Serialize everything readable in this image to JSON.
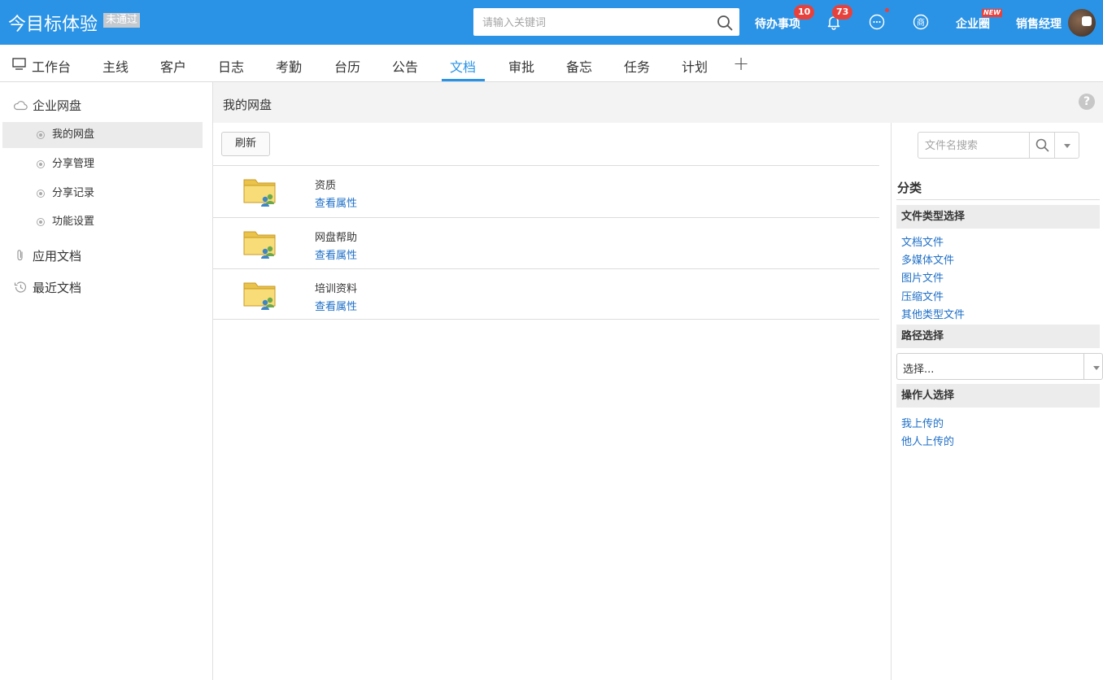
{
  "app": {
    "title": "今目标体验",
    "status_badge": "未通过"
  },
  "search": {
    "placeholder": "请输入关键词"
  },
  "top_links": {
    "todo_label": "待办事项",
    "todo_count": "10",
    "notify_count": "73",
    "circle_label": "企业圈",
    "circle_new_tag": "NEW",
    "user_role": "销售经理"
  },
  "icons": {
    "search": "search-icon",
    "bell": "bell-icon",
    "chat": "chat-bubble-icon",
    "shop": "shop-icon",
    "cloud": "cloud-icon",
    "paperclip": "paperclip-icon",
    "history": "history-icon",
    "help": "help-icon",
    "folder": "shared-folder-icon"
  },
  "colors": {
    "primary": "#2a93e6",
    "badge": "#e8413c",
    "link": "#1e6fc7"
  },
  "nav": {
    "tabs": [
      {
        "label": "工作台"
      },
      {
        "label": "主线"
      },
      {
        "label": "客户"
      },
      {
        "label": "日志"
      },
      {
        "label": "考勤"
      },
      {
        "label": "台历"
      },
      {
        "label": "公告"
      },
      {
        "label": "文档"
      },
      {
        "label": "审批"
      },
      {
        "label": "备忘"
      },
      {
        "label": "任务"
      },
      {
        "label": "计划"
      }
    ],
    "active": "文档",
    "add_label": "+"
  },
  "sidebar": {
    "groups": [
      {
        "label": "企业网盘"
      },
      {
        "label": "应用文档"
      },
      {
        "label": "最近文档"
      }
    ],
    "items": [
      {
        "label": "我的网盘"
      },
      {
        "label": "分享管理"
      },
      {
        "label": "分享记录"
      },
      {
        "label": "功能设置"
      }
    ],
    "active_item": "我的网盘"
  },
  "main": {
    "title": "我的网盘",
    "help_label": "?",
    "refresh_label": "刷新",
    "files": [
      {
        "name": "资质",
        "action": "查看属性"
      },
      {
        "name": "网盘帮助",
        "action": "查看属性"
      },
      {
        "name": "培训资料",
        "action": "查看属性"
      }
    ]
  },
  "right_panel": {
    "search_placeholder": "文件名搜索",
    "category_title": "分类",
    "file_type_title": "文件类型选择",
    "file_types": [
      "文档文件",
      "多媒体文件",
      "图片文件",
      "压缩文件",
      "其他类型文件"
    ],
    "path_title": "路径选择",
    "path_value": "选择...",
    "operator_title": "操作人选择",
    "operators": [
      "我上传的",
      "他人上传的"
    ]
  }
}
